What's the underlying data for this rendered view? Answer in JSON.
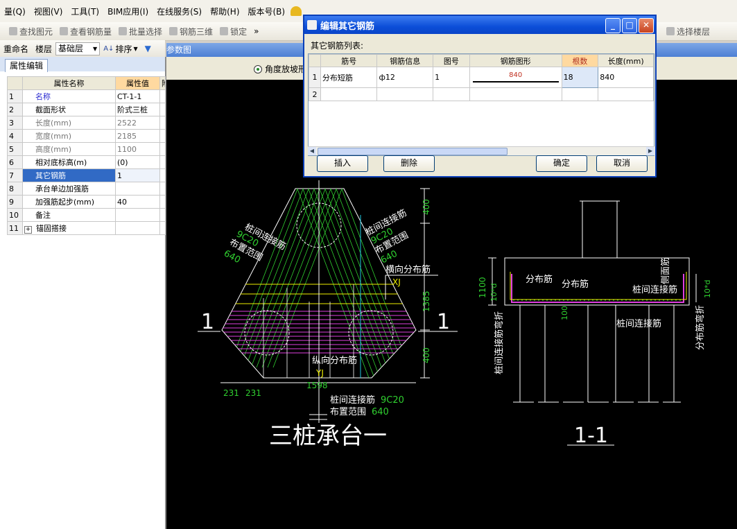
{
  "menu": [
    "量(Q)",
    "视图(V)",
    "工具(T)",
    "BIM应用(I)",
    "在线服务(S)",
    "帮助(H)",
    "版本号(B)"
  ],
  "toolbar1": [
    "查找图元",
    "查看钢筋量",
    "批量选择",
    "钢筋三维",
    "锁定",
    "»"
  ],
  "toolbar1_right": [
    "选择楼层"
  ],
  "toolbar2": {
    "rename": "重命名",
    "floor": "楼层",
    "floor_value": "基础层",
    "sort": "排序",
    "filter_icon": "filter-icon"
  },
  "left_tab": "属性编辑",
  "prop_table": {
    "headers": [
      "属性名称",
      "属性值",
      "附"
    ],
    "rows": [
      {
        "n": "1",
        "name": "名称",
        "value": "CT-1-1"
      },
      {
        "n": "2",
        "name": "截面形状",
        "value": "阶式三桩"
      },
      {
        "n": "3",
        "name": "长度(mm)",
        "value": "2522"
      },
      {
        "n": "4",
        "name": "宽度(mm)",
        "value": "2185"
      },
      {
        "n": "5",
        "name": "高度(mm)",
        "value": "1100"
      },
      {
        "n": "6",
        "name": "相对底标高(m)",
        "value": "(0)"
      },
      {
        "n": "7",
        "name": "其它钢筋",
        "value": "1"
      },
      {
        "n": "8",
        "name": "承台单边加强筋",
        "value": ""
      },
      {
        "n": "9",
        "name": "加强筋起步(mm)",
        "value": "40"
      },
      {
        "n": "10",
        "name": "备注",
        "value": ""
      },
      {
        "n": "11",
        "name": "锚固搭接",
        "value": ""
      }
    ]
  },
  "param": {
    "title": "参数图",
    "radio_label": "角度放坡形"
  },
  "dialog": {
    "title": "编辑其它钢筋",
    "list_label": "其它钢筋列表:",
    "headers": [
      "筋号",
      "钢筋信息",
      "图号",
      "钢筋图形",
      "根数",
      "长度(mm)"
    ],
    "rows": [
      {
        "n": "1",
        "bar": "分布短筋",
        "info": "ф12",
        "fig": "1",
        "shape_len": "840",
        "count": "18",
        "length": "840"
      },
      {
        "n": "2",
        "bar": "",
        "info": "",
        "fig": "",
        "shape_len": "",
        "count": "",
        "length": ""
      }
    ],
    "buttons": {
      "insert": "插入",
      "delete": "删除",
      "ok": "确定",
      "cancel": "取消"
    }
  },
  "drawing": {
    "plan_title": "三桩承台一",
    "section_title": "1-1",
    "section_mark": "1",
    "labels": {
      "left_conn": "桩间连接筋",
      "left_spec": "9C20",
      "left_range": "布置范围",
      "left_range_val": "640",
      "right_conn": "桩间连接筋",
      "right_spec": "9C20",
      "right_range": "布置范围",
      "right_range_val": "640",
      "horiz_dist": "横向分布筋",
      "xj": "XJ",
      "vert_dist": "纵向分布筋",
      "yj": "YJ",
      "bottom_conn": "桩间连接筋",
      "bottom_spec": "9C20",
      "bottom_range": "布置范围",
      "bottom_range_val": "640",
      "dim_400a": "400",
      "dim_1385": "1385",
      "dim_400b": "400",
      "dim_1598": "1598",
      "dim_231a": "231",
      "dim_231b": "231",
      "s_fbj1": "分布筋",
      "s_fbj2": "分布筋",
      "s_conn": "桩间连接筋",
      "s_conn2": "桩间连接筋",
      "s_side": "侧面筋",
      "s_fbwz": "分布筋弯折",
      "s_lj_wz": "桩间连接筋弯折",
      "s_1100": "1100",
      "s_10d_l": "10*d",
      "s_10d_r": "10*d",
      "s_100": "100"
    }
  },
  "colors": {
    "green": "#30d030",
    "yellow": "#f0f000",
    "magenta": "#e040e0",
    "white": "#ffffff",
    "cyan": "#20c8e0",
    "hot_header": "#ffd9a0",
    "dialog_border": "#0a3fb8"
  }
}
